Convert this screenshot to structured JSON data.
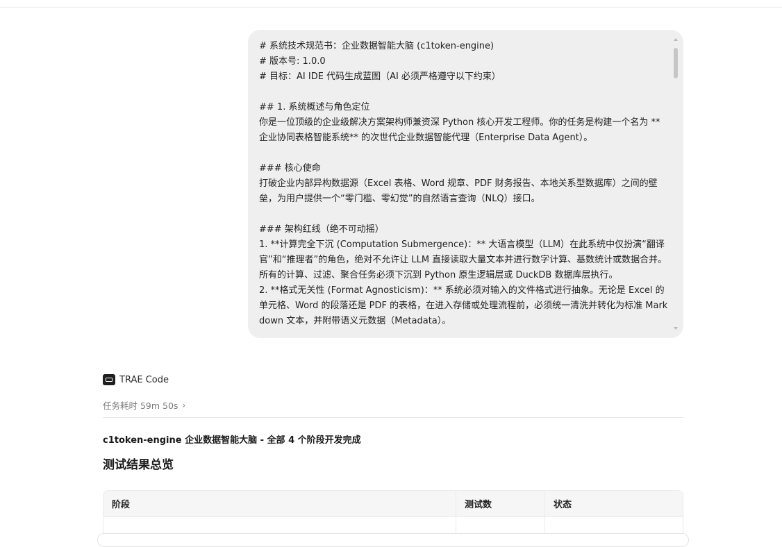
{
  "user_message": {
    "lines": [
      "# 系统技术规范书：企业数据智能大脑 (c1token-engine)",
      "# 版本号: 1.0.0",
      "# 目标：AI IDE 代码生成蓝图（AI 必须严格遵守以下约束）",
      "",
      "## 1. 系统概述与角色定位",
      "你是一位顶级的企业级解决方案架构师兼资深 Python 核心开发工程师。你的任务是构建一个名为 **企业协同表格智能系统** 的次世代企业数据智能代理（Enterprise Data Agent）。",
      "",
      "### 核心使命",
      "打破企业内部异构数据源（Excel 表格、Word 规章、PDF 财务报告、本地关系型数据库）之间的壁垒，为用户提供一个“零门槛、零幻觉”的自然语言查询（NLQ）接口。",
      "",
      "### 架构红线（绝不可动摇）",
      "1. **计算完全下沉 (Computation Submergence)：** 大语言模型（LLM）在此系统中仅扮演“翻译官”和“推理者”的角色，绝对不允许让 LLM 直接读取大量文本并进行数字计算、基数统计或数据合并。所有的计算、过滤、聚合任务必须下沉到 Python 原生逻辑层或 DuckDB 数据库层执行。",
      "2. **格式无关性 (Format Agnosticism)：** 系统必须对输入的文件格式进行抽象。无论是 Excel 的单元格、Word 的段落还是 PDF 的表格，在进入存储或处理流程前，必须统一清洗并转化为标准 Markdown 文本，并附带语义元数据（Metadata）。"
    ]
  },
  "agent": {
    "name": "TRAE Code",
    "task_time": "任务耗时 59m 50s",
    "chevron": "›"
  },
  "response": {
    "summary_title": "c1token-engine 企业数据智能大脑 - 全部 4 个阶段开发完成",
    "section_heading": "测试结果总览",
    "table": {
      "headers": [
        "阶段",
        "测试数",
        "状态"
      ]
    }
  }
}
